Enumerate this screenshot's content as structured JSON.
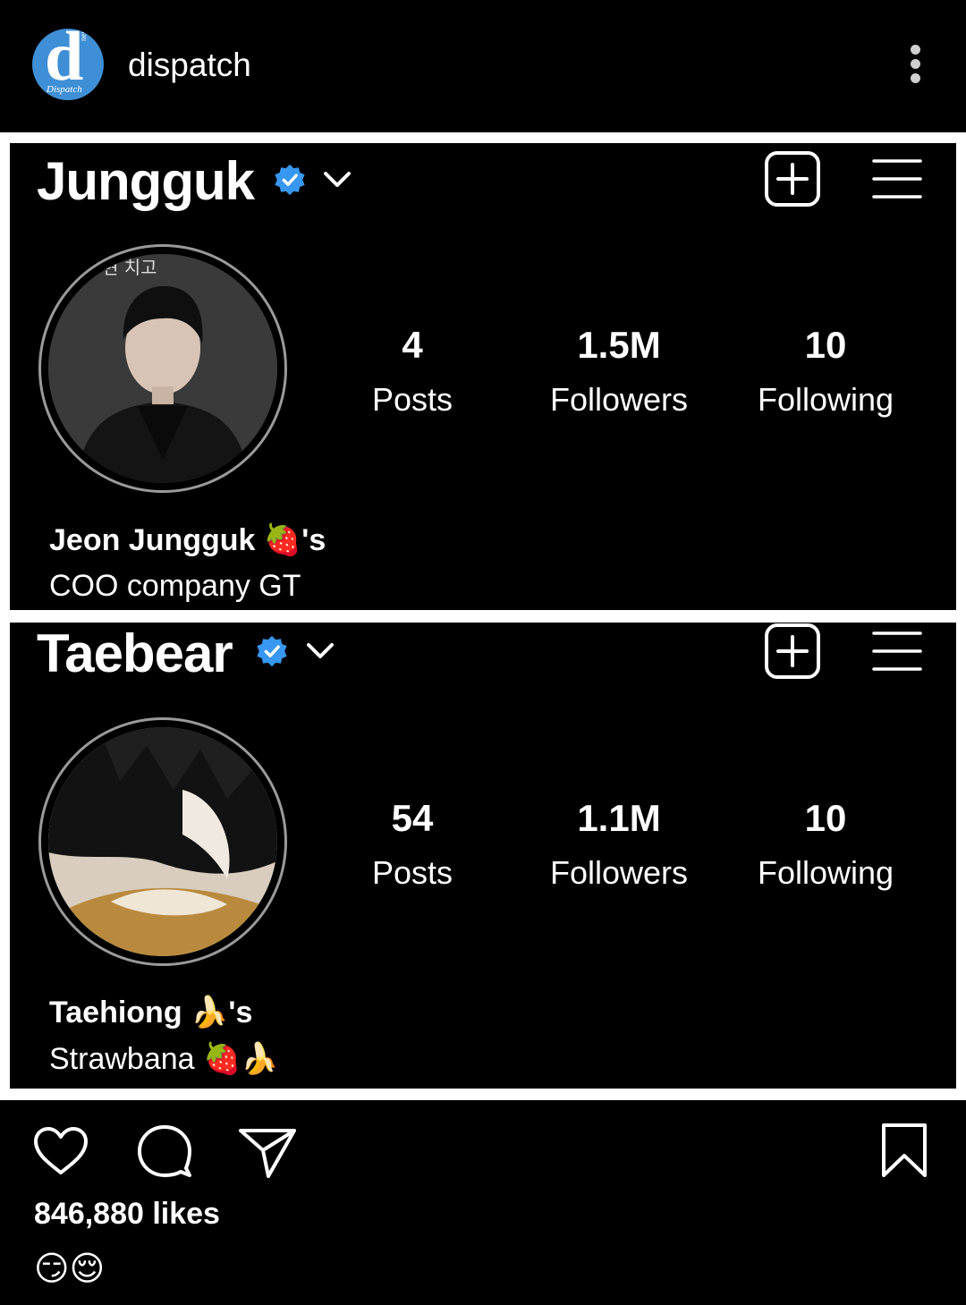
{
  "post": {
    "account": "dispatch",
    "logo_letter": "d",
    "logo_wordmark": "Dispatch",
    "logo_tag": "news"
  },
  "profiles": [
    {
      "handle": "Jungguk",
      "stats": [
        {
          "value": "4",
          "label": "Posts"
        },
        {
          "value": "1.5M",
          "label": "Followers"
        },
        {
          "value": "10",
          "label": "Following"
        }
      ],
      "bio_name": "Jeon Jungguk 🍓's",
      "bio_line": "COO company GT"
    },
    {
      "handle": "Taebear",
      "stats": [
        {
          "value": "54",
          "label": "Posts"
        },
        {
          "value": "1.1M",
          "label": "Followers"
        },
        {
          "value": "10",
          "label": "Following"
        }
      ],
      "bio_name": "Taehiong 🍌's",
      "bio_line": "Strawbana 🍓🍌"
    }
  ],
  "engagement": {
    "likes": "846,880 likes",
    "caption": "😏😌"
  },
  "icons": {
    "verified": "verified-badge-icon",
    "dropdown": "chevron-down-icon",
    "create": "add-square-icon",
    "menu": "hamburger-menu-icon",
    "like": "heart-icon",
    "comment": "comment-bubble-icon",
    "share": "send-icon",
    "save": "bookmark-icon",
    "more": "vertical-dots-icon"
  },
  "colors": {
    "background": "#000000",
    "frame": "#ffffff",
    "verified_blue": "#3897f0",
    "logo_blue": "#3f8fd6"
  }
}
